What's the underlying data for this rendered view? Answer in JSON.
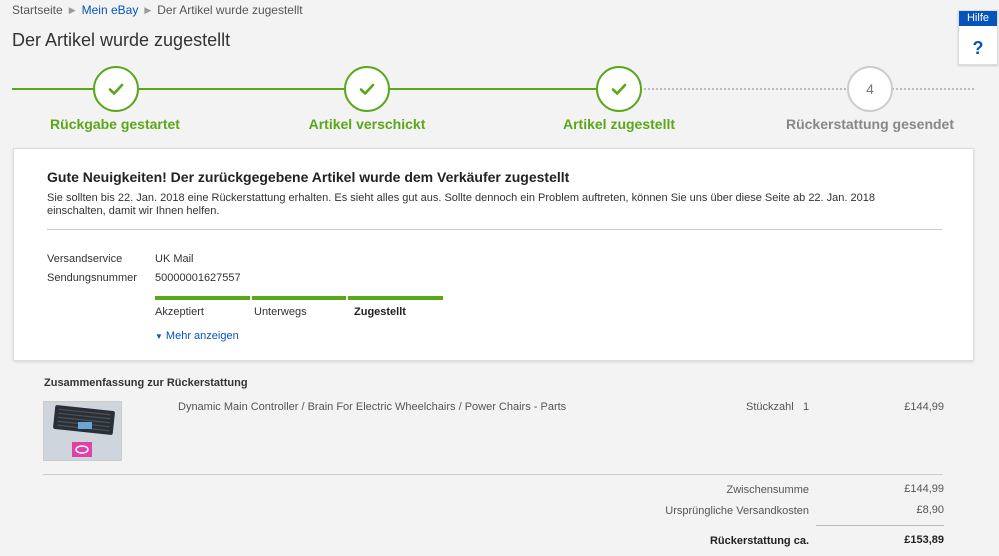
{
  "breadcrumb": {
    "home": "Startseite",
    "my_ebay": "Mein eBay",
    "current": "Der Artikel wurde zugestellt"
  },
  "page_title": "Der Artikel wurde zugestellt",
  "help": {
    "tab_label": "Hilfe",
    "icon_text": "?"
  },
  "tracker": {
    "steps": [
      {
        "label": "Rückgabe gestartet",
        "status": "done"
      },
      {
        "label": "Artikel verschickt",
        "status": "done"
      },
      {
        "label": "Artikel zugestellt",
        "status": "done"
      },
      {
        "label": "Rückerstattung gesendet",
        "status": "pending",
        "number": "4"
      }
    ]
  },
  "card": {
    "heading": "Gute Neuigkeiten! Der zurückgegebene Artikel wurde dem Verkäufer zugestellt",
    "message": "Sie sollten bis 22. Jan. 2018 eine Rückerstattung erhalten. Es sieht alles gut aus. Sollte dennoch ein Problem auftreten, können Sie uns über diese Seite ab 22. Jan. 2018 einschalten, damit wir Ihnen helfen.",
    "shipping_service_label": "Versandservice",
    "shipping_service_value": "UK Mail",
    "tracking_number_label": "Sendungsnummer",
    "tracking_number_value": "50000001627557",
    "tracking_stages": [
      "Akzeptiert",
      "Unterwegs",
      "Zugestellt"
    ],
    "more_link": "Mehr anzeigen"
  },
  "summary": {
    "title": "Zusammenfassung zur Rückerstattung",
    "item": {
      "title": "Dynamic Main Controller / Brain For Electric Wheelchairs / Power Chairs - Parts",
      "qty_label": "Stückzahl",
      "qty": "1",
      "price": "£144,99"
    },
    "subtotal_label": "Zwischensumme",
    "subtotal_value": "£144,99",
    "shipping_label": "Ursprüngliche Versandkosten",
    "shipping_value": "£8,90",
    "total_label": "Rückerstattung ca.",
    "total_value": "£153,89"
  },
  "colors": {
    "accent_green": "#5ba71b",
    "link_blue": "#0654ba"
  }
}
